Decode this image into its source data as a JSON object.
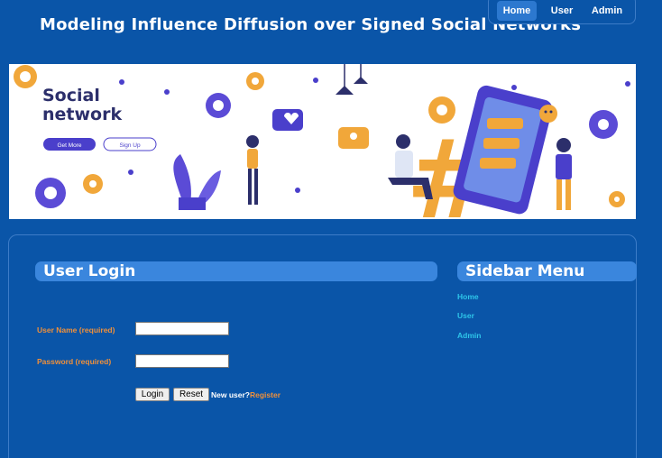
{
  "header": {
    "title": "Modeling Influence Diffusion over Signed Social Networks"
  },
  "topnav": {
    "home": "Home",
    "user": "User",
    "admin": "Admin"
  },
  "banner": {
    "headline_line1": "Social",
    "headline_line2": "network",
    "btn_get_more": "Get More",
    "btn_sign_up": "Sign Up",
    "symbol": "#"
  },
  "login": {
    "title": "User Login",
    "username_label": "User Name (required)",
    "password_label": "Password (required)",
    "username_value": "",
    "password_value": "",
    "login_label": "Login",
    "reset_label": "Reset",
    "new_user_text": "New user?",
    "register_label": "Register"
  },
  "sidebar": {
    "title": "Sidebar Menu",
    "items": [
      "Home",
      "User",
      "Admin"
    ]
  },
  "colors": {
    "background": "#0a55a8",
    "header_bar": "#3a86dd",
    "label_orange": "#f0903a",
    "link_cyan": "#2ec6ea"
  }
}
